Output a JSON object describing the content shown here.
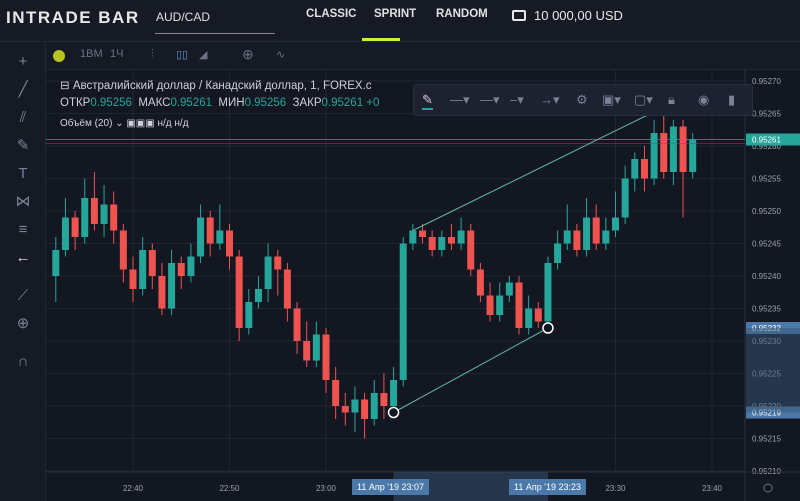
{
  "header": {
    "logo": "INTRADE BAR",
    "pair": "AUD/CAD",
    "modes": [
      "CLASSIC",
      "SPRINT",
      "RANDOM"
    ],
    "active_mode": "SPRINT",
    "balance": "10 000,00 USD",
    "accent": "#c8f03c"
  },
  "toolbar": {
    "items": [
      "1ВМ",
      "1Ч"
    ]
  },
  "legend": {
    "title": "Австралийский доллар / Канадский доллар, 1, FOREX.c",
    "open_label": "ОТКР",
    "open": "0.95256",
    "high_label": "МАКС",
    "high": "0.95261",
    "low_label": "МИН",
    "low": "0.95256",
    "close_label": "ЗАКР",
    "close": "0.95261",
    "change": "+0",
    "volume": "Объём (20)",
    "na1": "н/д",
    "na2": "н/д"
  },
  "colors": {
    "up": "#26a69a",
    "down": "#ef5350",
    "bg": "#131722",
    "trend": "#5fb8a6"
  },
  "chart_data": {
    "type": "candlestick",
    "interval_minutes": 1,
    "price_ticks": [
      "0.95270",
      "0.95265",
      "0.95260",
      "0.95255",
      "0.95250",
      "0.95245",
      "0.95240",
      "0.95235",
      "0.95230",
      "0.95225",
      "0.95220",
      "0.95215",
      "0.95210"
    ],
    "time_ticks": [
      "22:40",
      "22:50",
      "23:00",
      "23:30",
      "23:40"
    ],
    "ylim": [
      0.95209,
      0.95272
    ],
    "current_price": "0.95261",
    "marker_labels": [
      "0.95232",
      "0.95219"
    ],
    "time_labels": [
      "11 Апр '19   23:07",
      "11 Апр '19   23:23"
    ],
    "trendlines": [
      {
        "from": [
          "23:07",
          0.95219
        ],
        "to": [
          "23:23",
          0.95232
        ]
      },
      {
        "from": [
          "23:09",
          0.95247
        ],
        "to": [
          "23:35",
          0.95266
        ]
      }
    ],
    "candles": [
      [
        "22:32",
        0.9524,
        0.95246,
        0.95236,
        0.95244
      ],
      [
        "22:33",
        0.95244,
        0.95252,
        0.95243,
        0.95249
      ],
      [
        "22:34",
        0.95249,
        0.9525,
        0.95244,
        0.95246
      ],
      [
        "22:35",
        0.95246,
        0.95255,
        0.95245,
        0.95252
      ],
      [
        "22:36",
        0.95252,
        0.95256,
        0.95247,
        0.95248
      ],
      [
        "22:37",
        0.95248,
        0.95254,
        0.95246,
        0.95251
      ],
      [
        "22:38",
        0.95251,
        0.95253,
        0.95245,
        0.95247
      ],
      [
        "22:39",
        0.95247,
        0.95248,
        0.95239,
        0.95241
      ],
      [
        "22:40",
        0.95241,
        0.95243,
        0.95236,
        0.95238
      ],
      [
        "22:41",
        0.95238,
        0.95246,
        0.95237,
        0.95244
      ],
      [
        "22:42",
        0.95244,
        0.95245,
        0.95238,
        0.9524
      ],
      [
        "22:43",
        0.9524,
        0.95242,
        0.95234,
        0.95235
      ],
      [
        "22:44",
        0.95235,
        0.95244,
        0.95234,
        0.95242
      ],
      [
        "22:45",
        0.95242,
        0.95243,
        0.95238,
        0.9524
      ],
      [
        "22:46",
        0.9524,
        0.95245,
        0.95239,
        0.95243
      ],
      [
        "22:47",
        0.95243,
        0.95251,
        0.95242,
        0.95249
      ],
      [
        "22:48",
        0.95249,
        0.9525,
        0.95243,
        0.95245
      ],
      [
        "22:49",
        0.95245,
        0.95251,
        0.95244,
        0.95247
      ],
      [
        "22:50",
        0.95247,
        0.95248,
        0.95241,
        0.95243
      ],
      [
        "22:51",
        0.95243,
        0.95244,
        0.9523,
        0.95232
      ],
      [
        "22:52",
        0.95232,
        0.95238,
        0.95231,
        0.95236
      ],
      [
        "22:53",
        0.95236,
        0.9524,
        0.95235,
        0.95238
      ],
      [
        "22:54",
        0.95238,
        0.95245,
        0.95236,
        0.95243
      ],
      [
        "22:55",
        0.95243,
        0.95244,
        0.95237,
        0.95241
      ],
      [
        "22:56",
        0.95241,
        0.95242,
        0.95233,
        0.95235
      ],
      [
        "22:57",
        0.95235,
        0.95236,
        0.95228,
        0.9523
      ],
      [
        "22:58",
        0.9523,
        0.95233,
        0.95226,
        0.95227
      ],
      [
        "22:59",
        0.95227,
        0.95233,
        0.95226,
        0.95231
      ],
      [
        "23:00",
        0.95231,
        0.95232,
        0.95222,
        0.95224
      ],
      [
        "23:01",
        0.95224,
        0.95226,
        0.95218,
        0.9522
      ],
      [
        "23:02",
        0.9522,
        0.95222,
        0.95217,
        0.95219
      ],
      [
        "23:03",
        0.95219,
        0.95223,
        0.95216,
        0.95221
      ],
      [
        "23:04",
        0.95221,
        0.95222,
        0.95215,
        0.95218
      ],
      [
        "23:05",
        0.95218,
        0.95224,
        0.95217,
        0.95222
      ],
      [
        "23:06",
        0.95222,
        0.95225,
        0.95218,
        0.9522
      ],
      [
        "23:07",
        0.9522,
        0.95226,
        0.95219,
        0.95224
      ],
      [
        "23:08",
        0.95224,
        0.95246,
        0.95223,
        0.95245
      ],
      [
        "23:09",
        0.95245,
        0.95248,
        0.95244,
        0.95247
      ],
      [
        "23:10",
        0.95247,
        0.95248,
        0.95245,
        0.95246
      ],
      [
        "23:11",
        0.95246,
        0.95247,
        0.95243,
        0.95244
      ],
      [
        "23:12",
        0.95244,
        0.95247,
        0.95243,
        0.95246
      ],
      [
        "23:13",
        0.95246,
        0.95248,
        0.95244,
        0.95245
      ],
      [
        "23:14",
        0.95245,
        0.95249,
        0.95244,
        0.95247
      ],
      [
        "23:15",
        0.95247,
        0.95248,
        0.9524,
        0.95241
      ],
      [
        "23:16",
        0.95241,
        0.95242,
        0.95236,
        0.95237
      ],
      [
        "23:17",
        0.95237,
        0.95239,
        0.95233,
        0.95234
      ],
      [
        "23:18",
        0.95234,
        0.95239,
        0.95233,
        0.95237
      ],
      [
        "23:19",
        0.95237,
        0.9524,
        0.95236,
        0.95239
      ],
      [
        "23:20",
        0.95239,
        0.9524,
        0.95231,
        0.95232
      ],
      [
        "23:21",
        0.95232,
        0.95237,
        0.95231,
        0.95235
      ],
      [
        "23:22",
        0.95235,
        0.95236,
        0.95232,
        0.95233
      ],
      [
        "23:23",
        0.95233,
        0.95243,
        0.95232,
        0.95242
      ],
      [
        "23:24",
        0.95242,
        0.95247,
        0.95241,
        0.95245
      ],
      [
        "23:25",
        0.95245,
        0.95251,
        0.95244,
        0.95247
      ],
      [
        "23:26",
        0.95247,
        0.95248,
        0.95243,
        0.95244
      ],
      [
        "23:27",
        0.95244,
        0.95252,
        0.95243,
        0.95249
      ],
      [
        "23:28",
        0.95249,
        0.95251,
        0.95244,
        0.95245
      ],
      [
        "23:29",
        0.95245,
        0.95249,
        0.95244,
        0.95247
      ],
      [
        "23:30",
        0.95247,
        0.95253,
        0.95246,
        0.95249
      ],
      [
        "23:31",
        0.95249,
        0.95257,
        0.95248,
        0.95255
      ],
      [
        "23:32",
        0.95255,
        0.95259,
        0.95253,
        0.95258
      ],
      [
        "23:33",
        0.95258,
        0.9526,
        0.95253,
        0.95255
      ],
      [
        "23:34",
        0.95255,
        0.95264,
        0.95254,
        0.95262
      ],
      [
        "23:35",
        0.95262,
        0.95265,
        0.95255,
        0.95256
      ],
      [
        "23:36",
        0.95256,
        0.95264,
        0.95254,
        0.95263
      ],
      [
        "23:37",
        0.95263,
        0.95264,
        0.95249,
        0.95256
      ],
      [
        "23:38",
        0.95256,
        0.95262,
        0.95255,
        0.95261
      ]
    ]
  }
}
